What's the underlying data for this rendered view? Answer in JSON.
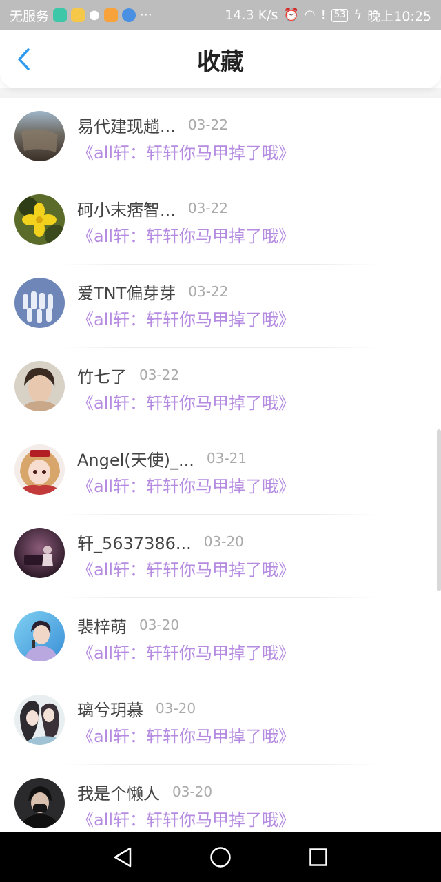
{
  "status_bar": {
    "carrier": "无服务",
    "more": "···",
    "speed": "14.3 K/s",
    "battery": "53",
    "time": "晚上10:25"
  },
  "header": {
    "title": "收藏",
    "back_icon": "chevron-left-icon"
  },
  "colors": {
    "accent": "#2f9bf0",
    "title_text": "#b48be0",
    "date_text": "#aaaaaa",
    "status_bar": "#bdbdbd"
  },
  "items": [
    {
      "user": "易代建现趟...",
      "date": "03-22",
      "title": "《all轩：轩轩你马甲掉了哦》"
    },
    {
      "user": "砢小末痞智...",
      "date": "03-22",
      "title": "《all轩：轩轩你马甲掉了哦》"
    },
    {
      "user": "爱TNT偏芽芽",
      "date": "03-22",
      "title": "《all轩：轩轩你马甲掉了哦》"
    },
    {
      "user": "竹七了",
      "date": "03-22",
      "title": "《all轩：轩轩你马甲掉了哦》"
    },
    {
      "user": "Angel(天使)_...",
      "date": "03-21",
      "title": "《all轩：轩轩你马甲掉了哦》"
    },
    {
      "user": "轩_5637386...",
      "date": "03-20",
      "title": "《all轩：轩轩你马甲掉了哦》"
    },
    {
      "user": "裴梓萌",
      "date": "03-20",
      "title": "《all轩：轩轩你马甲掉了哦》"
    },
    {
      "user": "璃兮玥慕",
      "date": "03-20",
      "title": "《all轩：轩轩你马甲掉了哦》"
    },
    {
      "user": "我是个懒人",
      "date": "03-20",
      "title": "《all轩：轩轩你马甲掉了哦》"
    }
  ],
  "nav_bar": {
    "back_icon": "triangle-back-icon",
    "home_icon": "circle-home-icon",
    "recents_icon": "square-recents-icon"
  }
}
